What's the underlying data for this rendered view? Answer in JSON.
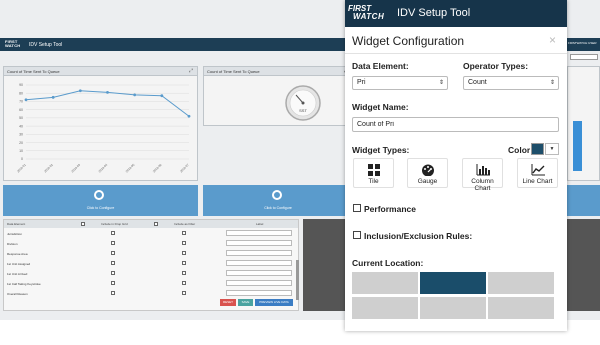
{
  "background": {
    "logo": [
      "FIRST",
      "WATCH"
    ],
    "app_title": "IDV Setup Tool",
    "user": "FIRSTWATCH USER",
    "chart_card": {
      "title": "Count of Time Sent To Queue",
      "chart_data": {
        "type": "line",
        "title": "Count of Time Sent To Queue",
        "x": [
          "2018-01",
          "2018-02",
          "2018-03",
          "2018-04",
          "2018-05",
          "2018-06",
          "2018-07"
        ],
        "values": [
          72,
          75,
          83,
          81,
          78,
          77,
          52
        ],
        "ylim": [
          0,
          90
        ],
        "yticks": [
          0,
          10,
          20,
          30,
          40,
          50,
          60,
          70,
          80,
          90
        ],
        "grid": true,
        "color": "#5a9bcc"
      }
    },
    "gauge_card": {
      "title": "Count of Time Sent To Queue",
      "gauge_caption": "SST"
    },
    "config_tile_label": "Click to Configure",
    "table": {
      "headers": [
        "Data Element",
        "Include in Drop Grid",
        "Include as Filter",
        "Label"
      ],
      "rows": [
        "Jurisdiction",
        "Division",
        "Response Area",
        "1st Unit Assigned",
        "1st Unit Arrived",
        "1st Call Taking Keystroke",
        "Overall Reason"
      ]
    },
    "buttons": {
      "reset": "RESET",
      "save": "SAVE",
      "preview": "PREVIEW LIVE DATA"
    }
  },
  "modal": {
    "logo": [
      "FIRST",
      "WATCH"
    ],
    "app_name": "IDV Setup Tool",
    "title": "Widget Configuration",
    "close_symbol": "×",
    "data_element_label": "Data Element:",
    "data_element_value": "Pri",
    "operator_label": "Operator Types:",
    "operator_value": "Count",
    "widget_name_label": "Widget Name:",
    "widget_name_value": "Count of Pri",
    "widget_types_label": "Widget Types:",
    "color_label": "Color:",
    "color_value": "#1d4e6a",
    "widget_types": [
      {
        "label": "Tile",
        "icon": "grid-icon"
      },
      {
        "label": "Gauge",
        "icon": "gauge-icon"
      },
      {
        "label": "Column Chart",
        "icon": "column-chart-icon"
      },
      {
        "label": "Line Chart",
        "icon": "line-chart-icon"
      }
    ],
    "performance_label": "Performance",
    "inclusion_label": "Inclusion/Exclusion Rules:",
    "current_location_label": "Current Location:",
    "active_location": 1,
    "caret": "⇕",
    "color_caret": "▼"
  }
}
